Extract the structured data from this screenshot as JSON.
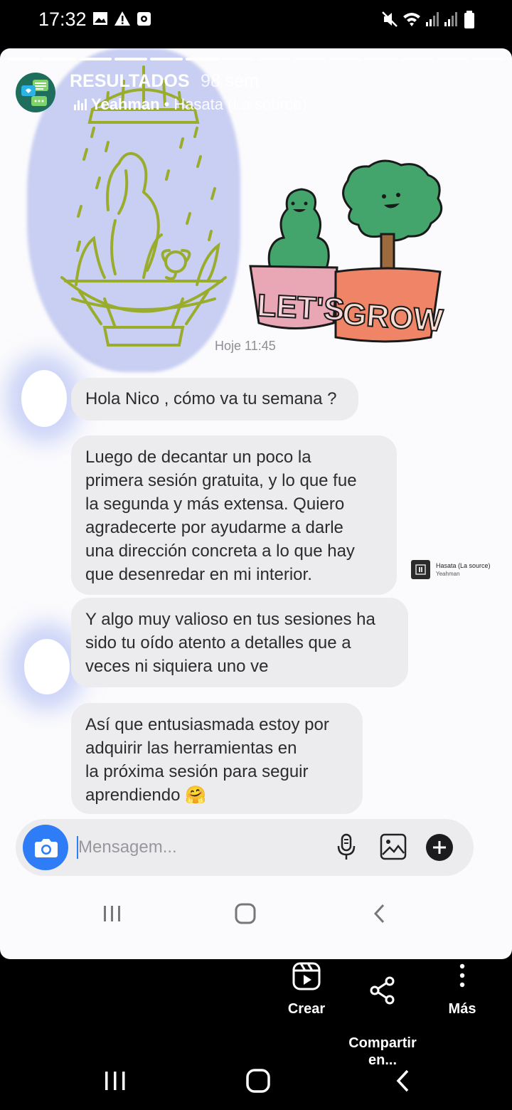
{
  "status_bar": {
    "time": "17:32"
  },
  "story": {
    "account": "RESULTADOS",
    "age": "98 sem",
    "music_artist": "Yeahman",
    "music_separator": "•",
    "music_track": "Hasata (La source)",
    "segments_total": 14,
    "segments_done": 6
  },
  "sticker": {
    "left_pot": "LET'S",
    "right_pot": "GROW"
  },
  "chat": {
    "timestamp": "Hoje 11:45",
    "messages": [
      {
        "text": "Hola Nico , cómo va tu semana ?"
      },
      {
        "text": "Luego de decantar un poco la\nprimera sesión gratuita, y lo que fue\nla segunda y más extensa. Quiero\nagradecerte por ayudarme a darle\nuna dirección concreta  a lo que hay\nque desenredar en mi interior."
      },
      {
        "text": "Y algo muy valioso en tus sesiones ha\nsido tu oído atento a detalles que a\nveces ni siquiera uno ve"
      },
      {
        "text": "Así que entusiasmada estoy por\nadquirir las herramientas  en\nla próxima sesión para seguir\naprendiendo 🤗"
      }
    ],
    "composer_placeholder": "Mensagem..."
  },
  "music_sticker": {
    "title": "Hasata (La source)",
    "artist": "Yeahman"
  },
  "actions": {
    "create": "Crear",
    "share": "Compartir\nen...",
    "more": "Más"
  },
  "colors": {
    "accent_blue": "#2e7cf6",
    "bubble_gray": "#ececef",
    "glow_blue": "#c9cff2",
    "tree_green": "#43a46c",
    "pot_pink": "#e9a7b6",
    "pot_orange": "#ef8466",
    "line_olive": "#9aac2c"
  }
}
